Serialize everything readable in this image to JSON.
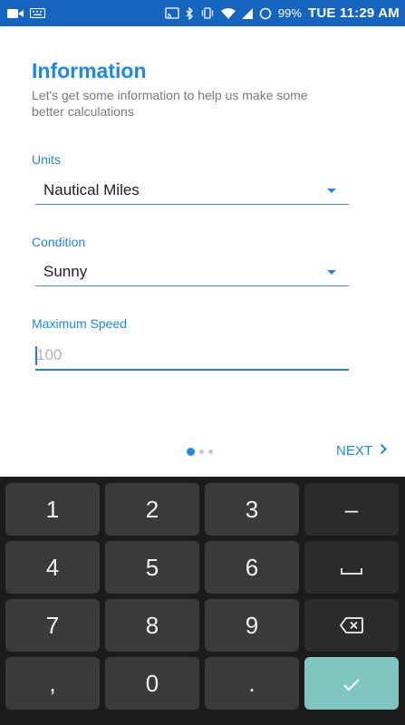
{
  "status_bar": {
    "battery": "99%",
    "time": "TUE 11:29 AM",
    "icons": [
      "video-camera-icon",
      "keyboard-icon",
      "cast-icon",
      "bluetooth-icon",
      "vibrate-icon",
      "wifi-icon",
      "cell-signal-icon",
      "circle-icon"
    ]
  },
  "page": {
    "title": "Information",
    "subtitle": "Let's get some information to help us make some better calculations"
  },
  "units": {
    "label": "Units",
    "value": "Nautical Miles"
  },
  "condition": {
    "label": "Condition",
    "value": "Sunny"
  },
  "max_speed": {
    "label": "Maximum Speed",
    "placeholder": "100",
    "value": ""
  },
  "pager": {
    "current": 1,
    "total": 3
  },
  "next": {
    "label": "NEXT"
  },
  "keyboard": {
    "keys": [
      "1",
      "2",
      "3",
      "–",
      "4",
      "5",
      "6",
      "␣",
      "7",
      "8",
      "9",
      "backspace",
      ",",
      "0",
      ".",
      "done"
    ]
  },
  "colors": {
    "status_bar": "#1565c0",
    "accent": "#1e88e5",
    "keyboard_bg": "#1b1b1b",
    "key_bg": "#3b3b3b",
    "done_key": "#7fc6c0"
  }
}
